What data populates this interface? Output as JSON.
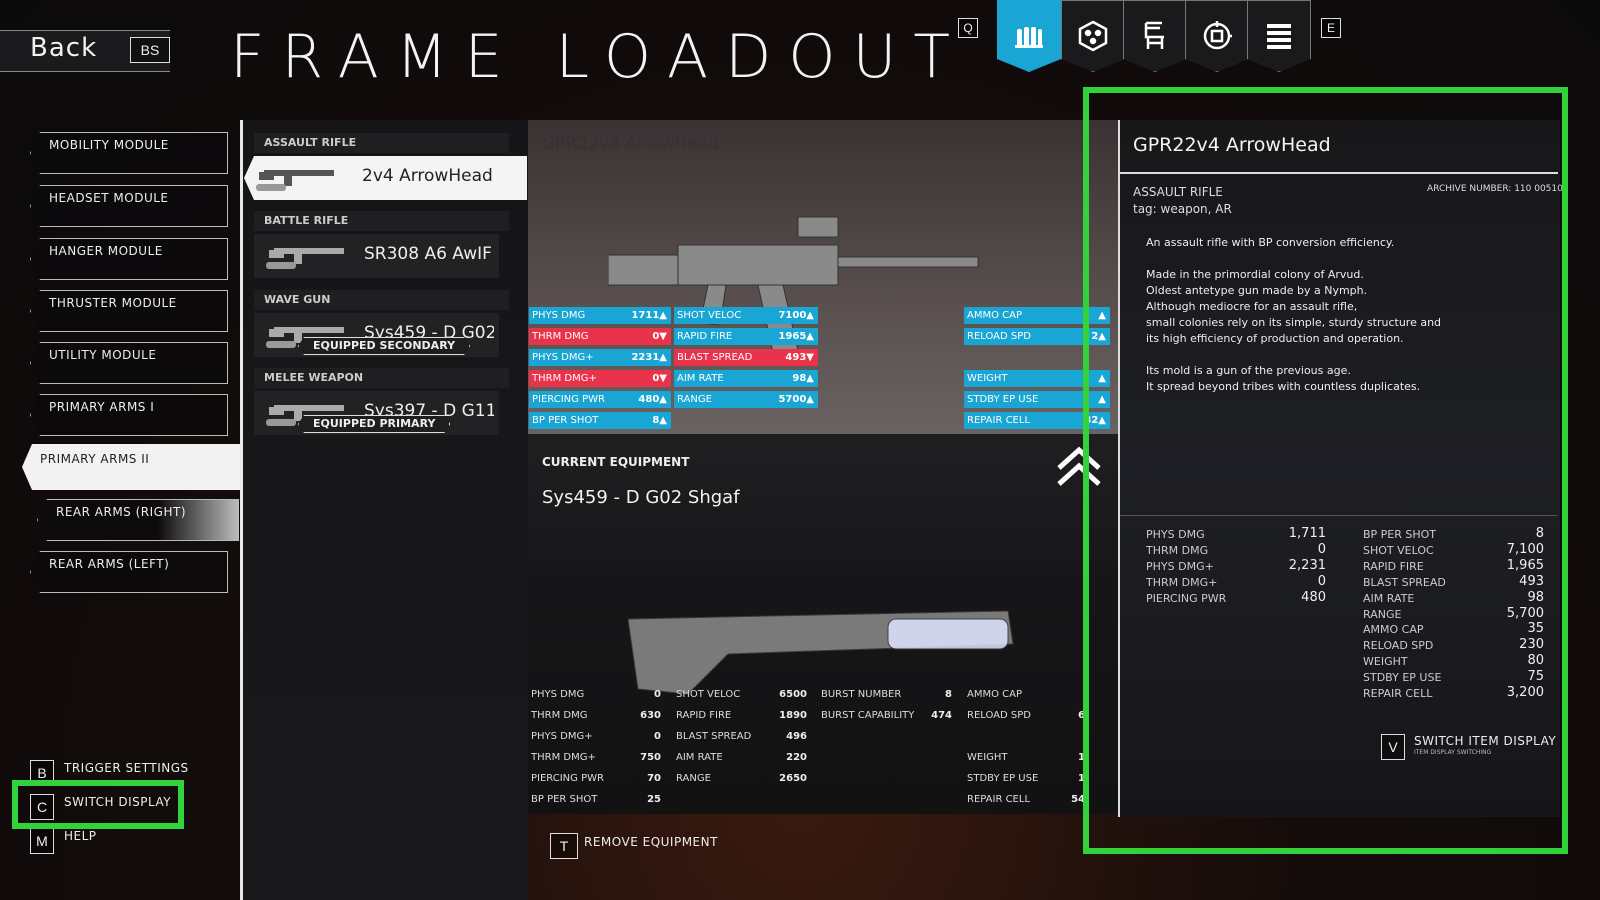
{
  "header": {
    "back_label": "Back",
    "back_key": "BS",
    "title": "FRAME LOADOUT",
    "left_key": "Q",
    "right_key": "E",
    "tabs": [
      {
        "icon": "ammo-icon",
        "active": true
      },
      {
        "icon": "frame-icon",
        "active": false
      },
      {
        "icon": "chair-icon",
        "active": false
      },
      {
        "icon": "chip-icon",
        "active": false
      },
      {
        "icon": "list-icon",
        "active": false
      }
    ]
  },
  "menu": {
    "items": [
      {
        "label": "MOBILITY MODULE"
      },
      {
        "label": "HEADSET MODULE"
      },
      {
        "label": "HANGER MODULE"
      },
      {
        "label": "THRUSTER MODULE"
      },
      {
        "label": "UTILITY MODULE"
      },
      {
        "label": "PRIMARY ARMS I"
      },
      {
        "label": "PRIMARY ARMS II",
        "active": true
      },
      {
        "label": "REAR ARMS (RIGHT)"
      },
      {
        "label": "REAR ARMS (LEFT)"
      }
    ]
  },
  "weapon_list": {
    "categories": [
      {
        "name": "ASSAULT RIFLE",
        "weapon": "2v4 ArrowHead",
        "badge": ""
      },
      {
        "name": "BATTLE RIFLE",
        "weapon": "SR308 A6 AwIF",
        "badge": ""
      },
      {
        "name": "WAVE GUN",
        "weapon": "Sys459 - D G02",
        "badge": "EQUIPPED SECONDARY"
      },
      {
        "name": "MELEE WEAPON",
        "weapon": "Sys397 - D G11 I",
        "badge": "EQUIPPED PRIMARY"
      }
    ]
  },
  "preview": {
    "name": "GPR22v4 ArrowHead",
    "stats_col1": [
      {
        "label": "PHYS DMG",
        "value": "1711▲",
        "color": "blue"
      },
      {
        "label": "THRM DMG",
        "value": "0▼",
        "color": "red"
      },
      {
        "label": "PHYS DMG+",
        "value": "2231▲",
        "color": "blue"
      },
      {
        "label": "THRM DMG+",
        "value": "0▼",
        "color": "red"
      },
      {
        "label": "PIERCING PWR",
        "value": "480▲",
        "color": "blue"
      },
      {
        "label": "BP PER SHOT",
        "value": "8▲",
        "color": "blue"
      }
    ],
    "stats_col2": [
      {
        "label": "SHOT VELOC",
        "value": "7100▲",
        "color": "blue"
      },
      {
        "label": "RAPID FIRE",
        "value": "1965▲",
        "color": "blue"
      },
      {
        "label": "BLAST SPREAD",
        "value": "493▼",
        "color": "red"
      },
      {
        "label": "AIM RATE",
        "value": "98▲",
        "color": "blue"
      },
      {
        "label": "RANGE",
        "value": "5700▲",
        "color": "blue"
      }
    ],
    "stats_col3": [
      {
        "label": "AMMO CAP",
        "value": "▲",
        "color": "blue",
        "row": 0
      },
      {
        "label": "RELOAD SPD",
        "value": "2▲",
        "color": "blue",
        "row": 1
      },
      {
        "label": "WEIGHT",
        "value": "▲",
        "color": "blue",
        "row": 3
      },
      {
        "label": "STDBY EP USE",
        "value": "▲",
        "color": "blue",
        "row": 4
      },
      {
        "label": "REPAIR CELL",
        "value": "32▲",
        "color": "blue",
        "row": 5
      }
    ]
  },
  "current": {
    "label": "CURRENT EQUIPMENT",
    "name": "Sys459 - D G02 Shgaf",
    "col1": [
      {
        "label": "PHYS DMG",
        "value": "0"
      },
      {
        "label": "THRM DMG",
        "value": "630"
      },
      {
        "label": "PHYS DMG+",
        "value": "0"
      },
      {
        "label": "THRM DMG+",
        "value": "750"
      },
      {
        "label": "PIERCING PWR",
        "value": "70"
      },
      {
        "label": "BP PER SHOT",
        "value": "25"
      }
    ],
    "col2": [
      {
        "label": "SHOT VELOC",
        "value": "6500"
      },
      {
        "label": "RAPID FIRE",
        "value": "1890"
      },
      {
        "label": "BLAST SPREAD",
        "value": "496"
      },
      {
        "label": "AIM RATE",
        "value": "220"
      },
      {
        "label": "RANGE",
        "value": "2650"
      }
    ],
    "col3": [
      {
        "label": "BURST NUMBER",
        "value": "8"
      },
      {
        "label": "BURST CAPABILITY",
        "value": "474"
      }
    ],
    "col4": [
      {
        "label": "AMMO CAP",
        "value": "",
        "row": 0
      },
      {
        "label": "RELOAD SPD",
        "value": "6",
        "row": 1
      },
      {
        "label": "WEIGHT",
        "value": "1",
        "row": 3
      },
      {
        "label": "STDBY EP USE",
        "value": "1",
        "row": 4
      },
      {
        "label": "REPAIR CELL",
        "value": "54",
        "row": 5
      }
    ],
    "remove_key": "T",
    "remove_label": "REMOVE EQUIPMENT"
  },
  "detail": {
    "title": "GPR22v4 ArrowHead",
    "category": "ASSAULT RIFLE",
    "tag": "tag: weapon, AR",
    "archive": "ARCHIVE NUMBER: 110 00510",
    "description": "An assault rifle with BP conversion efficiency.\n\nMade in the primordial colony of Arvud.\nOldest antetype gun made by a Nymph.\nAlthough mediocre for an assault rifle,\nsmall colonies rely on its simple, sturdy structure and\nits high efficiency of production and operation.\n\nIts mold is a gun of the previous age.\nIt spread beyond tribes with countless duplicates.",
    "left_stats": [
      {
        "label": "PHYS DMG",
        "value": "1,711"
      },
      {
        "label": "THRM DMG",
        "value": "0"
      },
      {
        "label": "PHYS DMG+",
        "value": "2,231"
      },
      {
        "label": "THRM DMG+",
        "value": "0"
      },
      {
        "label": "PIERCING PWR",
        "value": "480"
      }
    ],
    "right_stats": [
      {
        "label": "BP PER SHOT",
        "value": "8"
      },
      {
        "label": "SHOT VELOC",
        "value": "7,100"
      },
      {
        "label": "RAPID FIRE",
        "value": "1,965"
      },
      {
        "label": "BLAST SPREAD",
        "value": "493"
      },
      {
        "label": "AIM RATE",
        "value": "98"
      },
      {
        "label": "RANGE",
        "value": "5,700"
      },
      {
        "label": "AMMO CAP",
        "value": "35"
      },
      {
        "label": "RELOAD SPD",
        "value": "230"
      },
      {
        "label": "WEIGHT",
        "value": "80"
      },
      {
        "label": "STDBY EP USE",
        "value": "75"
      },
      {
        "label": "REPAIR CELL",
        "value": "3,200"
      }
    ],
    "switch_key": "V",
    "switch_label": "SWITCH ITEM DISPLAY",
    "switch_sub": "ITEM DISPLAY SWITCHING"
  },
  "bottom_keys": [
    {
      "key": "B",
      "label": "TRIGGER SETTINGS"
    },
    {
      "key": "C",
      "label": "SWITCH DISPLAY"
    },
    {
      "key": "M",
      "label": "HELP"
    }
  ],
  "colors": {
    "accent": "#1aa6d4",
    "negative": "#e8334a",
    "highlight": "#33d13a"
  }
}
